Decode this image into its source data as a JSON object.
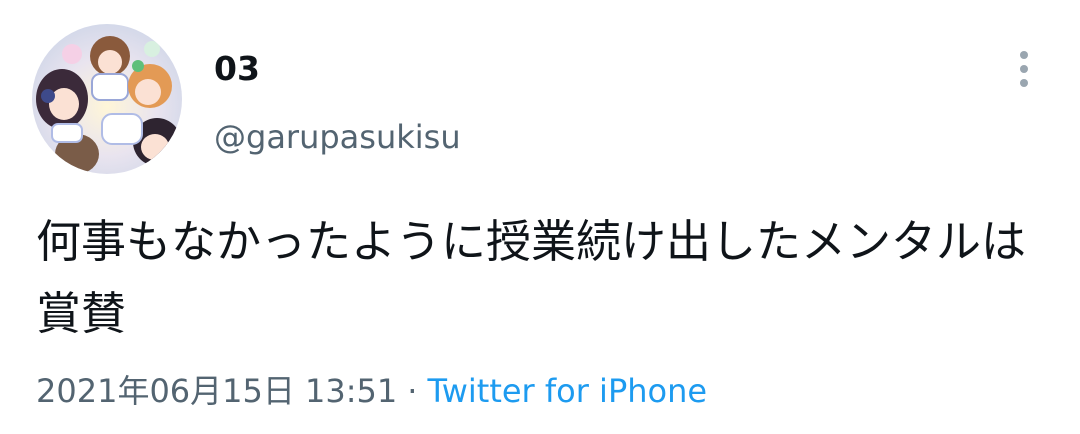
{
  "user": {
    "display_name": "03",
    "handle": "@garupasukisu"
  },
  "tweet": {
    "text": "何事もなかったように授業続け出したメンタルは賞賛",
    "date": "2021年06月15日 13:51",
    "separator": "·",
    "source": "Twitter for iPhone"
  },
  "icons": {
    "more": "more-vertical-icon"
  },
  "colors": {
    "text": "#0f1419",
    "secondary": "#536471",
    "link": "#1d9bf0"
  }
}
